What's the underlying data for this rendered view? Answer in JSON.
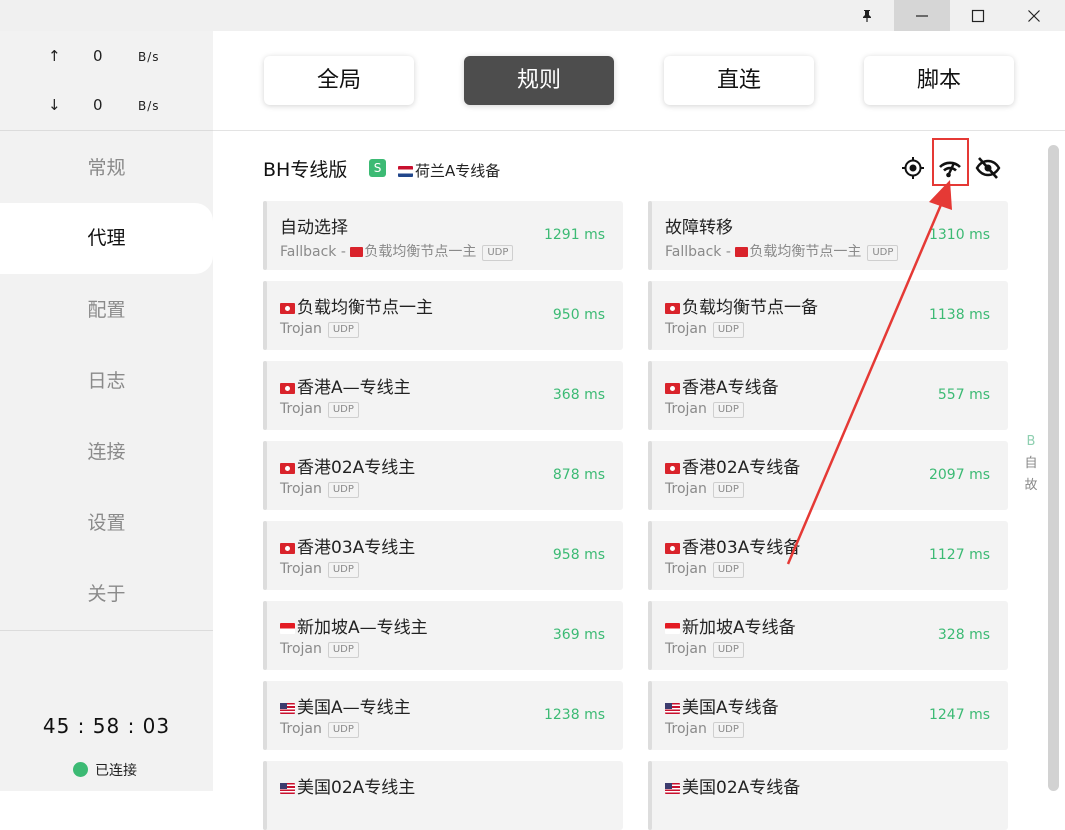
{
  "traffic": {
    "upload": {
      "arrow": "↑",
      "value": "0",
      "unit": "B/s"
    },
    "download": {
      "arrow": "↓",
      "value": "0",
      "unit": "B/s"
    }
  },
  "nav": {
    "items": [
      {
        "label": "常规"
      },
      {
        "label": "代理",
        "active": true
      },
      {
        "label": "配置"
      },
      {
        "label": "日志"
      },
      {
        "label": "连接"
      },
      {
        "label": "设置"
      },
      {
        "label": "关于"
      }
    ]
  },
  "status": {
    "timer": "45 : 58 : 03",
    "connection": "已连接",
    "connection_color": "#3cba74"
  },
  "modes": {
    "global": "全局",
    "rule": "规则",
    "direct": "直连",
    "script": "脚本",
    "active": "rule"
  },
  "group": {
    "name": "BH专线版",
    "badge": "S",
    "selected": "荷兰A专线备",
    "icons": [
      "locate-icon",
      "speed-test-icon",
      "hide-icon"
    ]
  },
  "proxies": [
    {
      "name": "自动选择",
      "type": "Fallback - ",
      "type_extra": "负载均衡节点一主",
      "udp": "UDP",
      "delay": "1291 ms"
    },
    {
      "name": "故障转移",
      "type": "Fallback - ",
      "type_extra": "负载均衡节点一主",
      "udp": "UDP",
      "delay": "1310 ms"
    },
    {
      "name": "负载均衡节点一主",
      "type": "Trojan",
      "udp": "UDP",
      "delay": "950 ms",
      "flag": "hk"
    },
    {
      "name": "负载均衡节点一备",
      "type": "Trojan",
      "udp": "UDP",
      "delay": "1138 ms",
      "flag": "hk"
    },
    {
      "name": "香港A—专线主",
      "type": "Trojan",
      "udp": "UDP",
      "delay": "368 ms",
      "flag": "hk"
    },
    {
      "name": "香港A专线备",
      "type": "Trojan",
      "udp": "UDP",
      "delay": "557 ms",
      "flag": "hk"
    },
    {
      "name": "香港02A专线主",
      "type": "Trojan",
      "udp": "UDP",
      "delay": "878 ms",
      "flag": "hk"
    },
    {
      "name": "香港02A专线备",
      "type": "Trojan",
      "udp": "UDP",
      "delay": "2097 ms",
      "flag": "hk"
    },
    {
      "name": "香港03A专线主",
      "type": "Trojan",
      "udp": "UDP",
      "delay": "958 ms",
      "flag": "hk"
    },
    {
      "name": "香港03A专线备",
      "type": "Trojan",
      "udp": "UDP",
      "delay": "1127 ms",
      "flag": "hk"
    },
    {
      "name": "新加坡A—专线主",
      "type": "Trojan",
      "udp": "UDP",
      "delay": "369 ms",
      "flag": "sg"
    },
    {
      "name": "新加坡A专线备",
      "type": "Trojan",
      "udp": "UDP",
      "delay": "328 ms",
      "flag": "sg"
    },
    {
      "name": "美国A—专线主",
      "type": "Trojan",
      "udp": "UDP",
      "delay": "1238 ms",
      "flag": "us"
    },
    {
      "name": "美国A专线备",
      "type": "Trojan",
      "udp": "UDP",
      "delay": "1247 ms",
      "flag": "us"
    },
    {
      "name": "美国02A专线主",
      "type": "",
      "udp": "",
      "delay": "",
      "flag": "us"
    },
    {
      "name": "美国02A专线备",
      "type": "",
      "udp": "",
      "delay": "",
      "flag": "us"
    }
  ],
  "side_letters": [
    "B",
    "自",
    "故"
  ],
  "colors": {
    "accent": "#3cba74",
    "active_tab": "#4d4d4d",
    "annotation": "#e53935"
  }
}
